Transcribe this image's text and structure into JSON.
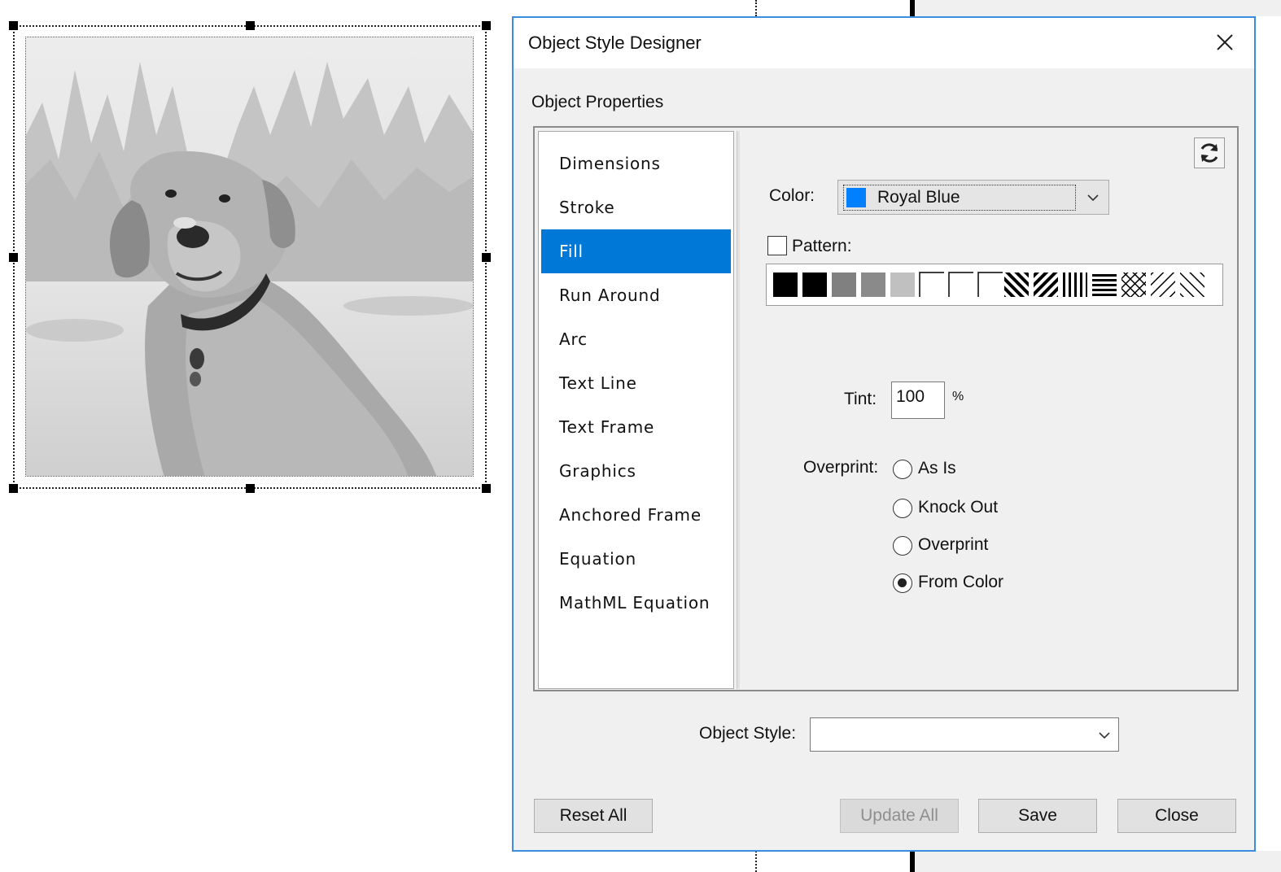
{
  "dialog": {
    "title": "Object Style Designer",
    "section_label": "Object Properties",
    "categories": [
      "Dimensions",
      "Stroke",
      "Fill",
      "Run Around",
      "Arc",
      "Text Line",
      "Text Frame",
      "Graphics",
      "Anchored Frame",
      "Equation",
      "MathML Equation"
    ],
    "selected_category": "Fill",
    "fill": {
      "color_label": "Color:",
      "color_value": "Royal Blue",
      "color_swatch": "#0080ff",
      "pattern_label": "Pattern:",
      "pattern_checked": false,
      "tint_label": "Tint:",
      "tint_value": "100",
      "tint_unit": "%",
      "overprint_label": "Overprint:",
      "overprint_options": [
        "As Is",
        "Knock Out",
        "Overprint",
        "From Color"
      ],
      "overprint_selected": "From Color"
    },
    "object_style_label": "Object Style:",
    "object_style_value": "",
    "buttons": {
      "reset_all": "Reset All",
      "update_all": "Update All",
      "save": "Save",
      "close": "Close"
    }
  },
  "accent_color": "#0078d7"
}
